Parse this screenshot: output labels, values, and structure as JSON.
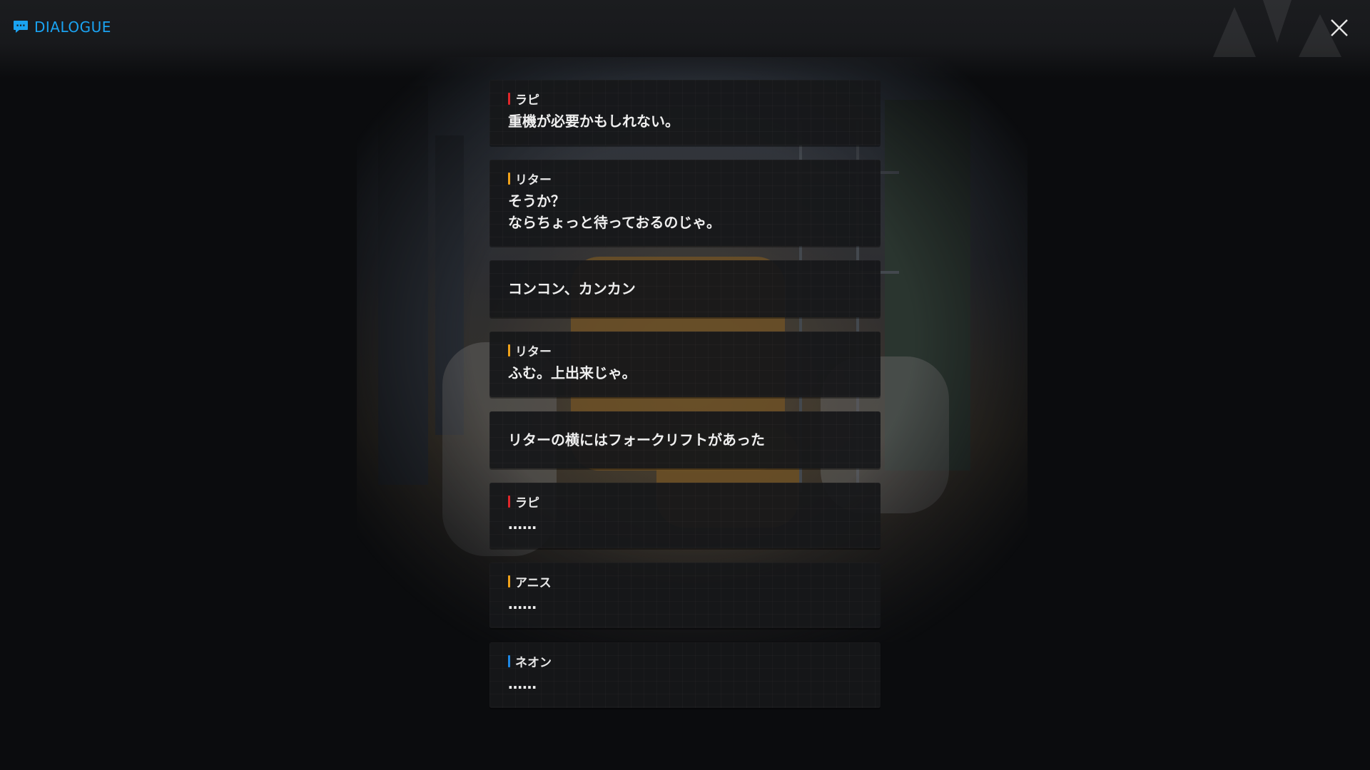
{
  "header": {
    "title": "DIALOGUE",
    "icon": "chat-bubble-icon",
    "accent_color": "#1aa3f2"
  },
  "close_button": {
    "icon": "close-icon"
  },
  "dialogue": [
    {
      "speaker": "ラピ",
      "speaker_color": "#e0262a",
      "text": "重機が必要かもしれない。"
    },
    {
      "speaker": "リター",
      "speaker_color": "#f0a21a",
      "text": "そうか？\nならちょっと待っておるのじゃ。"
    },
    {
      "speaker": "",
      "speaker_color": "",
      "text": "コンコン、カンカン"
    },
    {
      "speaker": "リター",
      "speaker_color": "#f0a21a",
      "text": "ふむ。上出来じゃ。"
    },
    {
      "speaker": "",
      "speaker_color": "",
      "text": "リターの横にはフォークリフトがあった"
    },
    {
      "speaker": "ラピ",
      "speaker_color": "#e0262a",
      "text": "……"
    },
    {
      "speaker": "アニス",
      "speaker_color": "#f0a21a",
      "text": "……"
    },
    {
      "speaker": "ネオン",
      "speaker_color": "#1e88e5",
      "text": "……"
    }
  ]
}
